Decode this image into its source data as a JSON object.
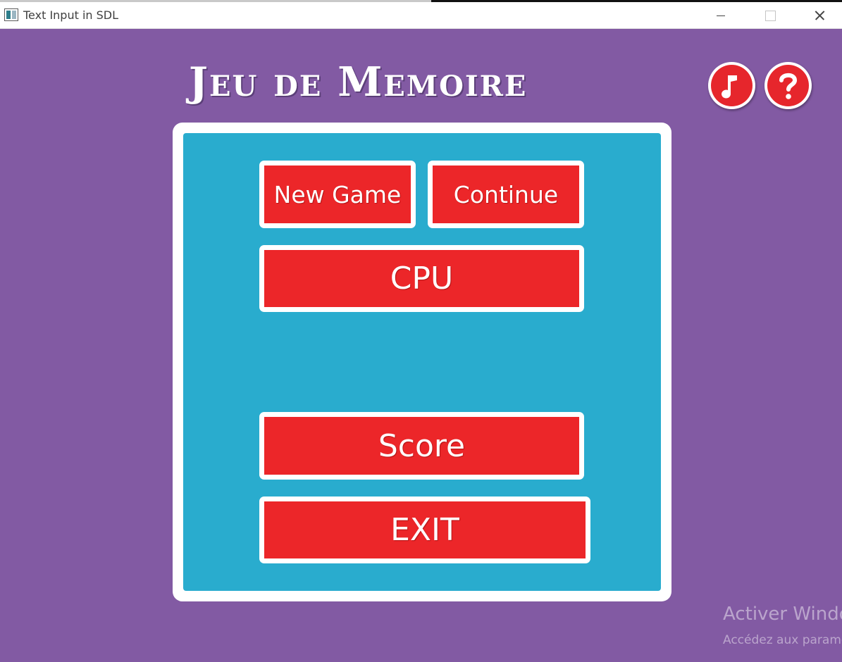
{
  "window": {
    "title": "Text Input in SDL",
    "icon": "app-window-icon"
  },
  "game": {
    "title": "Jeu de Memoire"
  },
  "icons": {
    "music": "music-note-icon",
    "help": "question-mark-icon"
  },
  "menu": {
    "new_game": "New Game",
    "continue": "Continue",
    "cpu": "CPU",
    "score": "Score",
    "exit": "EXIT"
  },
  "watermark": {
    "title": "Activer Windows",
    "subtitle": "Accédez aux paramètres pour activer Windows."
  },
  "colors": {
    "background": "#825aa3",
    "panel": "#29acce",
    "button": "#ec2629",
    "border": "#ffffff"
  }
}
